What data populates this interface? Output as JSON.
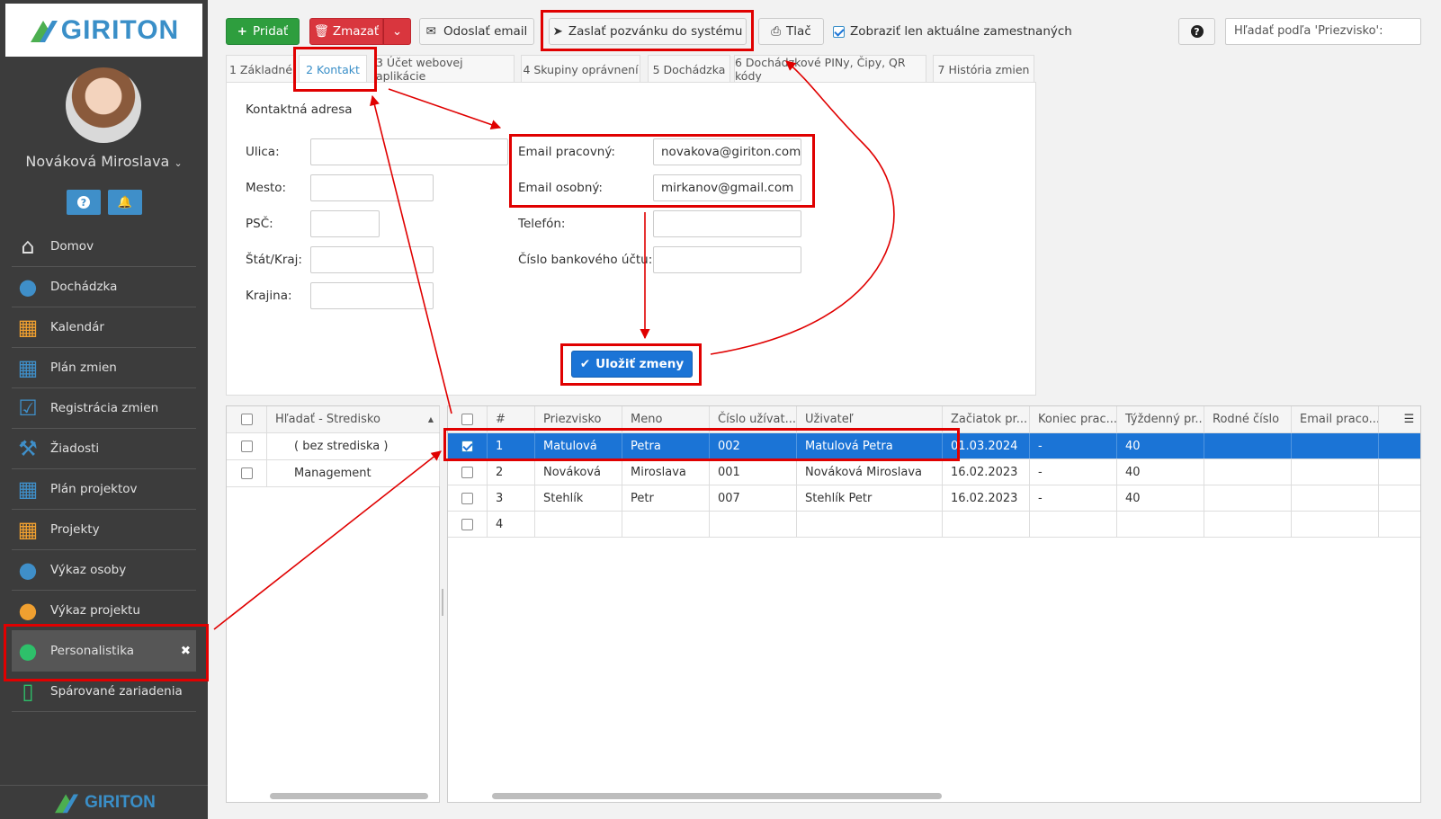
{
  "sidebar": {
    "logo": "GIRITON",
    "user_name": "Nováková Miroslava",
    "help_button": "?",
    "menu": [
      {
        "label": "Domov",
        "icon": "home-icon"
      },
      {
        "label": "Dochádzka",
        "icon": "person-icon"
      },
      {
        "label": "Kalendár",
        "icon": "calendar-icon"
      },
      {
        "label": "Plán zmien",
        "icon": "calendar-grid-icon"
      },
      {
        "label": "Registrácia zmien",
        "icon": "calendar-check-icon"
      },
      {
        "label": "Žiadosti",
        "icon": "gavel-icon"
      },
      {
        "label": "Plán projektov",
        "icon": "calendar-grid-icon"
      },
      {
        "label": "Projekty",
        "icon": "calendar-icon"
      },
      {
        "label": "Výkaz osoby",
        "icon": "person-icon"
      },
      {
        "label": "Výkaz projektu",
        "icon": "group-icon"
      },
      {
        "label": "Personalistika",
        "icon": "standing-person-icon",
        "active": true
      },
      {
        "label": "Spárované zariadenia",
        "icon": "mobile-icon"
      }
    ],
    "footer_logo": "GIRITON"
  },
  "toolbar": {
    "add": "Pridať",
    "delete": "Zmazať",
    "send_email": "Odoslať email",
    "send_invite": "Zaslať pozvánku do systému",
    "print": "Tlač",
    "only_current_label": "Zobraziť len aktuálne zamestnaných",
    "only_current_checked": true,
    "help": "?",
    "search_placeholder": "Hľadať podľa 'Priezvisko':"
  },
  "tabs": [
    "1 Základné",
    "2 Kontakt",
    "3 Účet webovej aplikácie",
    "4 Skupiny oprávnení",
    "5 Dochádzka",
    "6 Dochádzkové PINy, Čipy, QR kódy",
    "7 História zmien"
  ],
  "active_tab": "2 Kontakt",
  "contact_form": {
    "section_title": "Kontaktná adresa",
    "street_label": "Ulica:",
    "city_label": "Mesto:",
    "zip_label": "PSČ:",
    "state_label": "Štát/Kraj:",
    "country_label": "Krajina:",
    "work_email_label": "Email pracovný:",
    "work_email": "novakova@giriton.com",
    "personal_email_label": "Email osobný:",
    "personal_email": "mirkanov@gmail.com",
    "phone_label": "Telefón:",
    "bank_label": "Číslo bankového účtu:",
    "save": "Uložiť zmeny"
  },
  "center_grid": {
    "header": "Hľadať - Stredisko",
    "rows": [
      "( bez strediska )",
      "Management"
    ]
  },
  "employee_grid": {
    "columns": [
      "#",
      "Priezvisko",
      "Meno",
      "Číslo užívat...",
      "Uživateľ",
      "Začiatok pr...",
      "Koniec prac....",
      "Týždenný pr...",
      "Rodné číslo",
      "Email praco..."
    ],
    "rows": [
      {
        "n": "1",
        "surname": "Matulová",
        "name": "Petra",
        "num": "002",
        "user": "Matulová Petra",
        "start": "01.03.2024",
        "end": "-",
        "weekly": "40",
        "selected": true
      },
      {
        "n": "2",
        "surname": "Nováková",
        "name": "Miroslava",
        "num": "001",
        "user": "Nováková Miroslava",
        "start": "16.02.2023",
        "end": "-",
        "weekly": "40"
      },
      {
        "n": "3",
        "surname": "Stehlík",
        "name": "Petr",
        "num": "007",
        "user": "Stehlík Petr",
        "start": "16.02.2023",
        "end": "-",
        "weekly": "40"
      },
      {
        "n": "4",
        "surname": "",
        "name": "",
        "num": "",
        "user": "",
        "start": "",
        "end": "",
        "weekly": ""
      }
    ]
  },
  "colors": {
    "accent": "#1b74d6",
    "green": "#2e9e3e",
    "red": "#d9363e",
    "annotation": "#e00000"
  }
}
